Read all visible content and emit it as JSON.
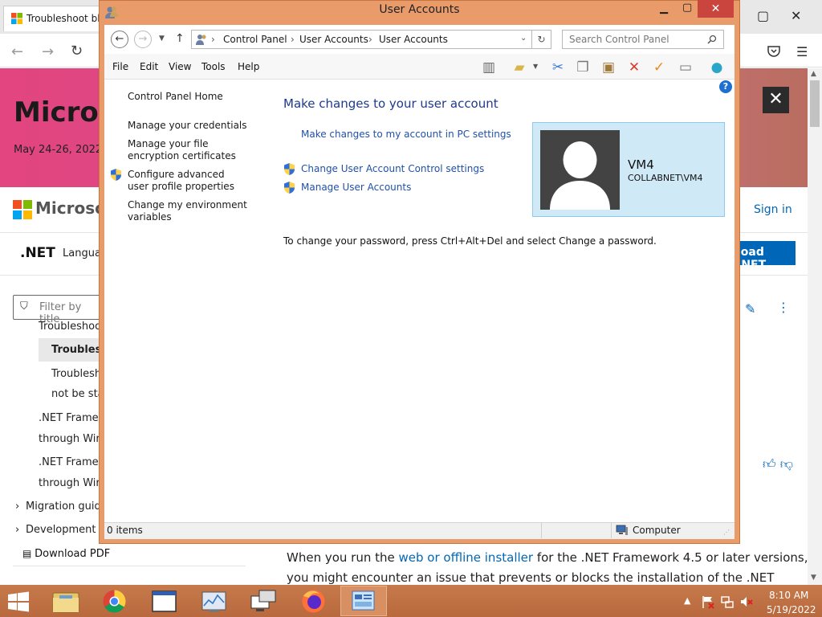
{
  "browser": {
    "tab_title": "Troubleshoot blo",
    "hero": {
      "title": "Microso",
      "date": "May 24-26, 2022"
    },
    "brand": "Microsoft",
    "sign_in": "Sign in",
    "nav": {
      "product": ".NET",
      "languages": "Langua",
      "download": "load .NET"
    },
    "filter_placeholder": "Filter by title",
    "toc": [
      "Troubleshoo",
      "Troublesh",
      "Troublesh",
      "not be sta",
      ".NET Framew",
      "through Wir",
      ".NET Framew",
      "through Wir",
      "Migration guid",
      "Development g"
    ],
    "download_pdf": "Download PDF",
    "body": {
      "line1_pre": "When you run the ",
      "line1_link": "web or offline installer",
      "line1_post": " for the .NET Framework 4.5 or later versions,",
      "line2": "you might encounter an issue that prevents or blocks the installation of the .NET"
    },
    "close_glyph": "✕"
  },
  "window": {
    "title": "User Accounts",
    "breadcrumb": [
      "Control Panel",
      "User Accounts",
      "User Accounts"
    ],
    "search_placeholder": "Search Control Panel",
    "menu": [
      "File",
      "Edit",
      "View",
      "Tools",
      "Help"
    ],
    "sidebar": {
      "home": "Control Panel Home",
      "credentials": "Manage your credentials",
      "encryption": "Manage your file encryption certificates",
      "profile": "Configure advanced user profile properties",
      "env": "Change my environment variables"
    },
    "content": {
      "heading": "Make changes to your user account",
      "pc_settings_link": "Make changes to my account in PC settings",
      "uac_link": "Change User Account Control settings",
      "manage_link": "Manage User Accounts",
      "password_text": "To change your password, press Ctrl+Alt+Del and select Change a password."
    },
    "user": {
      "name": "VM4",
      "domain": "COLLABNET\\VM4"
    },
    "status": {
      "items": "0 items",
      "location": "Computer"
    },
    "help_glyph": "?"
  },
  "taskbar": {
    "time": "8:10 AM",
    "date": "5/19/2022",
    "tray_arrow": "▲"
  },
  "colors": {
    "accent": "#0067b8",
    "titlebar": "#e99b6a",
    "taskbar": "#c67a4c",
    "link": "#2050a8",
    "close": "#c9453d"
  }
}
